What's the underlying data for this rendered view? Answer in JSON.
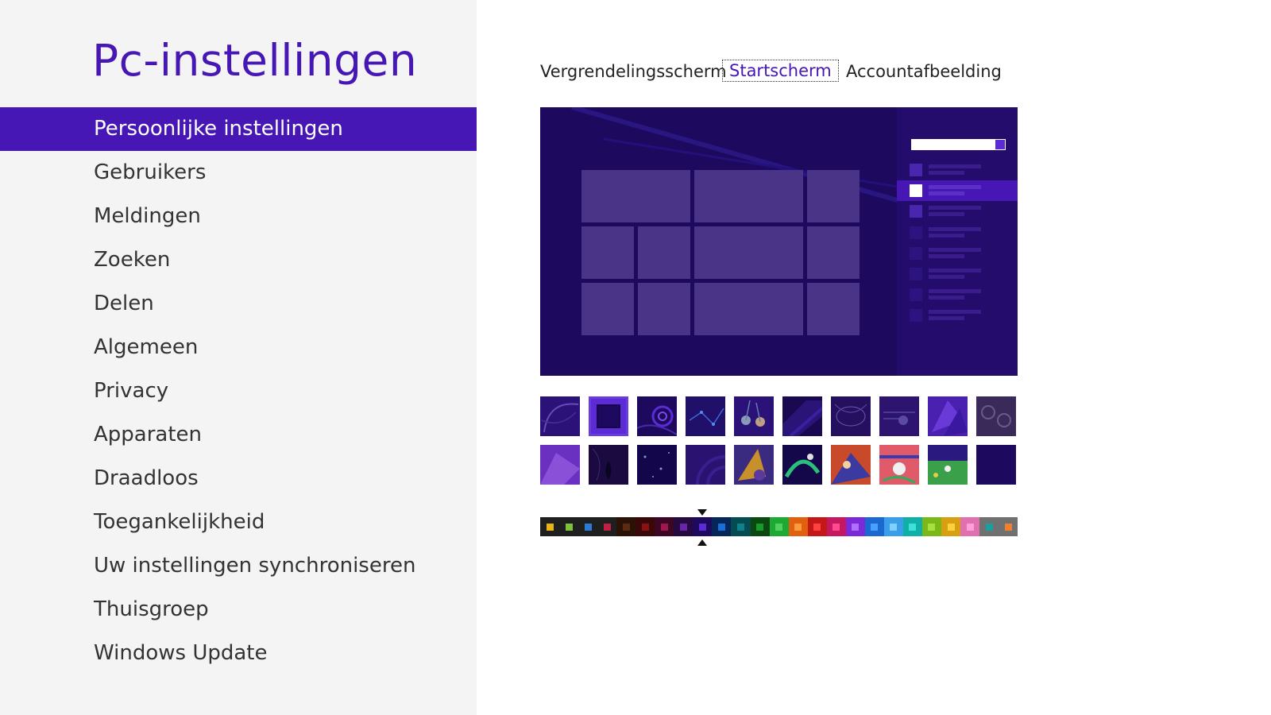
{
  "app": {
    "title": "Pc-instellingen"
  },
  "sidebar": {
    "items": [
      {
        "label": "Persoonlijke instellingen",
        "selected": true
      },
      {
        "label": "Gebruikers"
      },
      {
        "label": "Meldingen"
      },
      {
        "label": "Zoeken"
      },
      {
        "label": "Delen"
      },
      {
        "label": "Algemeen"
      },
      {
        "label": "Privacy"
      },
      {
        "label": "Apparaten"
      },
      {
        "label": "Draadloos"
      },
      {
        "label": "Toegankelijkheid"
      },
      {
        "label": "Uw instellingen synchroniseren"
      },
      {
        "label": "Thuisgroep"
      },
      {
        "label": "Windows Update"
      }
    ]
  },
  "tabs": [
    {
      "label": "Vergrendelingsscherm"
    },
    {
      "label": "Startscherm",
      "active": true
    },
    {
      "label": "Accountafbeelding"
    }
  ],
  "colors": {
    "accent": "#4617b4",
    "preview_background": "#1d0a5f",
    "tile": "#4a3488"
  },
  "background_patterns": {
    "selected_index": 1,
    "count": 20
  },
  "color_scheme": {
    "selected_index": 8,
    "swatches": [
      {
        "bg": "#1f1f1f",
        "dot": "#e8b418"
      },
      {
        "bg": "#1f1f1f",
        "dot": "#7cc23a"
      },
      {
        "bg": "#1f1f1f",
        "dot": "#2d7ad6"
      },
      {
        "bg": "#1f1f1f",
        "dot": "#c21f45"
      },
      {
        "bg": "#2a1207",
        "dot": "#5d2a12"
      },
      {
        "bg": "#3a0808",
        "dot": "#8a1212"
      },
      {
        "bg": "#3d0622",
        "dot": "#a01650"
      },
      {
        "bg": "#240a3f",
        "dot": "#6a24a8"
      },
      {
        "bg": "#1d0a5f",
        "dot": "#5b2bd6"
      },
      {
        "bg": "#06265a",
        "dot": "#1a6fd6"
      },
      {
        "bg": "#064a52",
        "dot": "#10808c"
      },
      {
        "bg": "#0a4a12",
        "dot": "#1a9a2a"
      },
      {
        "bg": "#1ea834",
        "dot": "#50d060"
      },
      {
        "bg": "#e06010",
        "dot": "#ff9a3a"
      },
      {
        "bg": "#c41818",
        "dot": "#ff4040"
      },
      {
        "bg": "#c41860",
        "dot": "#ff4a90"
      },
      {
        "bg": "#7a2ad6",
        "dot": "#b070ff"
      },
      {
        "bg": "#1a68d0",
        "dot": "#4aa0ff"
      },
      {
        "bg": "#3a9ee8",
        "dot": "#7fd0ff"
      },
      {
        "bg": "#10b0a8",
        "dot": "#40e0d8"
      },
      {
        "bg": "#7ab81a",
        "dot": "#a8e040"
      },
      {
        "bg": "#d8a010",
        "dot": "#ffd040"
      },
      {
        "bg": "#e070b0",
        "dot": "#ffa0d8"
      },
      {
        "bg": "#707070",
        "dot": "#18a0a0"
      },
      {
        "bg": "#707070",
        "dot": "#f08030"
      }
    ]
  }
}
